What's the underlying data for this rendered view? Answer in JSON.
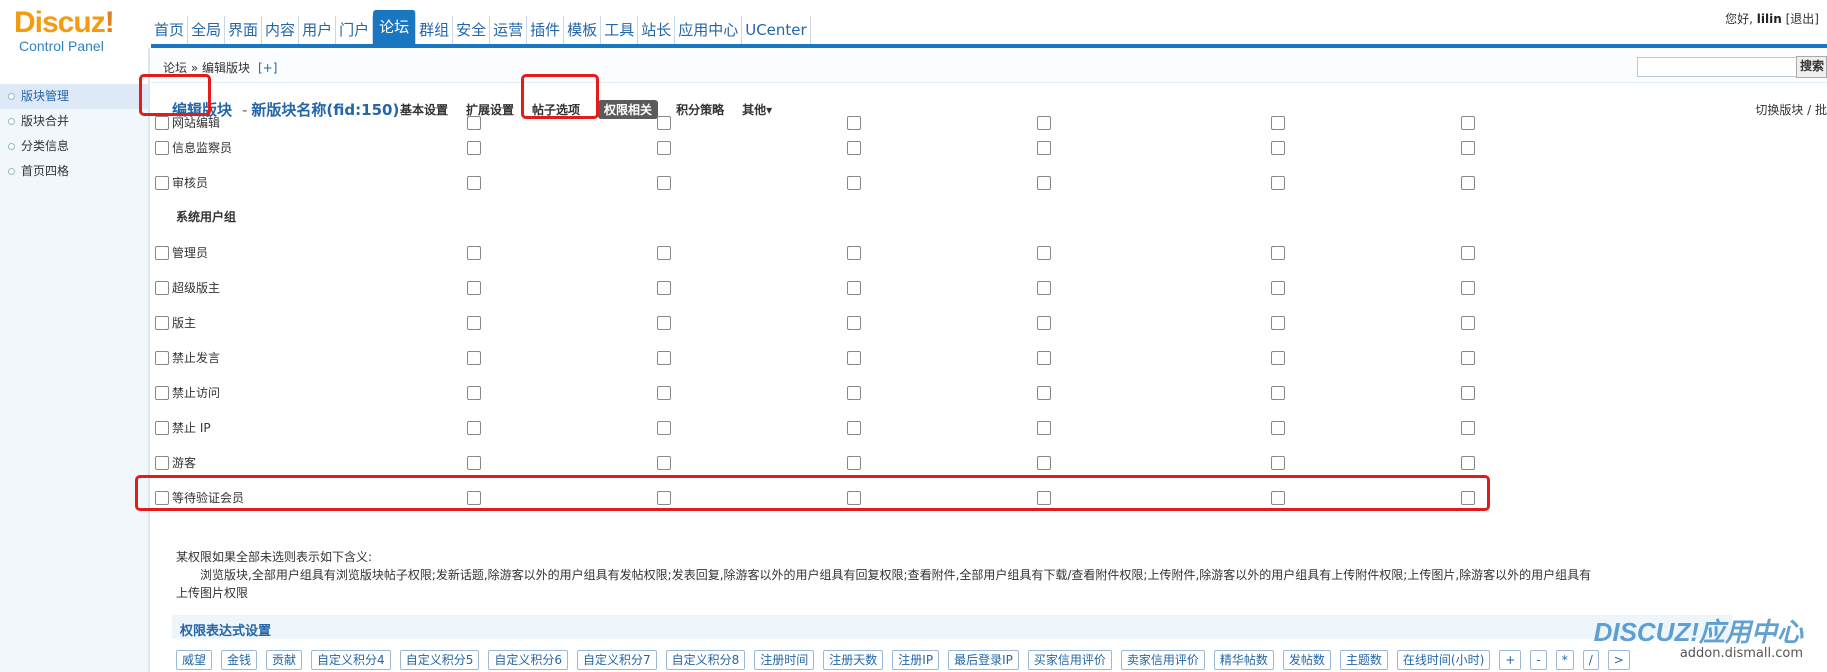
{
  "logo": {
    "brand": "Discuz",
    "bang": "!",
    "sub": "Control Panel"
  },
  "topnav": [
    "首页",
    "全局",
    "界面",
    "内容",
    "用户",
    "门户",
    "论坛",
    "群组",
    "安全",
    "运营",
    "插件",
    "模板",
    "工具",
    "站长",
    "应用中心",
    "UCenter"
  ],
  "topnav_active": "论坛",
  "user": {
    "greeting": "您好,",
    "name": "lilin",
    "logout": "[退出]"
  },
  "breadcrumb": {
    "text": "论坛 » 编辑版块",
    "plus": "[+]"
  },
  "search": {
    "button": "搜索"
  },
  "sidebar": {
    "items": [
      {
        "label": "版块管理",
        "active": true
      },
      {
        "label": "版块合并"
      },
      {
        "label": "分类信息"
      },
      {
        "label": "首页四格"
      }
    ]
  },
  "header": {
    "edit_title": "编辑版块",
    "forum_name": "新版块名称(fid:150)",
    "tabs": [
      "基本设置",
      "扩展设置",
      "帖子选项",
      "权限相关",
      "积分策略",
      "其他▾"
    ],
    "active_tab": "权限相关",
    "switch": "切换版块 / 批"
  },
  "permission_rows_top": [
    {
      "label": "网站编辑"
    },
    {
      "label": "信息监察员"
    },
    {
      "label": "审核员"
    }
  ],
  "system_group": {
    "title": "系统用户组",
    "rows": [
      {
        "label": "管理员"
      },
      {
        "label": "超级版主"
      },
      {
        "label": "版主"
      },
      {
        "label": "禁止发言"
      },
      {
        "label": "禁止访问"
      },
      {
        "label": "禁止 IP"
      },
      {
        "label": "游客",
        "highlighted": true
      },
      {
        "label": "等待验证会员"
      }
    ]
  },
  "note": {
    "line1": "某权限如果全部未选则表示如下含义:",
    "line2": "浏览版块,全部用户组具有浏览版块帖子权限;发新话题,除游客以外的用户组具有发帖权限;发表回复,除游客以外的用户组具有回复权限;查看附件,全部用户组具有下载/查看附件权限;上传附件,除游客以外的用户组具有上传附件权限;上传图片,除游客以外的用户组具有",
    "line3": "上传图片权限"
  },
  "expression": {
    "title": "权限表达式设置",
    "buttons": [
      "威望",
      "金钱",
      "贡献",
      "自定义积分4",
      "自定义积分5",
      "自定义积分6",
      "自定义积分7",
      "自定义积分8",
      "注册时间",
      "注册天数",
      "注册IP",
      "最后登录IP",
      "买家信用评价",
      "卖家信用评价",
      "精华帖数",
      "发帖数",
      "主题数",
      "在线时间(小时)",
      "+",
      "-",
      "*",
      "/",
      ">"
    ]
  },
  "watermark": {
    "brand": "DISCUZ!应用中心",
    "site": "addon.dismall.com"
  },
  "colors": {
    "accent": "#1977c1",
    "highlight": "#e31b1b",
    "link": "#2466a8"
  }
}
